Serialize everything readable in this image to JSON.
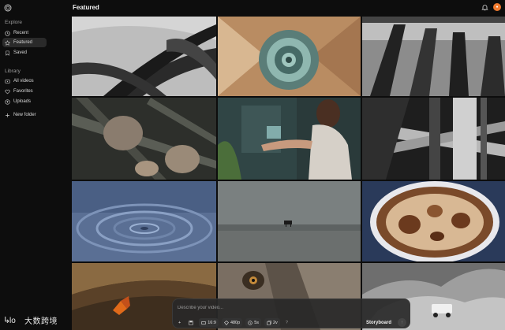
{
  "header": {
    "title": "Featured"
  },
  "sidebar": {
    "logo_icon": "swirl-logo-icon",
    "explore_label": "Explore",
    "explore_items": [
      {
        "label": "Recent",
        "icon": "clock-icon"
      },
      {
        "label": "Featured",
        "icon": "star-icon",
        "active": true
      },
      {
        "label": "Saved",
        "icon": "bookmark-icon"
      }
    ],
    "library_label": "Library",
    "library_items": [
      {
        "label": "All videos",
        "icon": "video-icon"
      },
      {
        "label": "Favorites",
        "icon": "heart-icon"
      },
      {
        "label": "Uploads",
        "icon": "upload-icon"
      }
    ],
    "new_folder_label": "New folder"
  },
  "topbar": {
    "avatar_initial": "●",
    "accent_color": "#f07a2e"
  },
  "prompt": {
    "placeholder": "Describe your video...",
    "add_label": "+",
    "aspect_ratio": "16:9",
    "resolution": "480p",
    "duration": "5s",
    "variations": "2v",
    "help_label": "?",
    "storyboard_label": "Storyboard",
    "send_label": "↑"
  },
  "watermark": {
    "text": "大数跨境"
  },
  "gallery": [
    "palm leaves in monochrome",
    "spiral paper sculpture",
    "architectural columns",
    "insects on leaves",
    "woman holding glass cube",
    "wooden pier structure",
    "water ripples",
    "piano on beach",
    "coffee latte foam",
    "butterfly",
    "monkey face close-up",
    "smoke and vehicle"
  ]
}
